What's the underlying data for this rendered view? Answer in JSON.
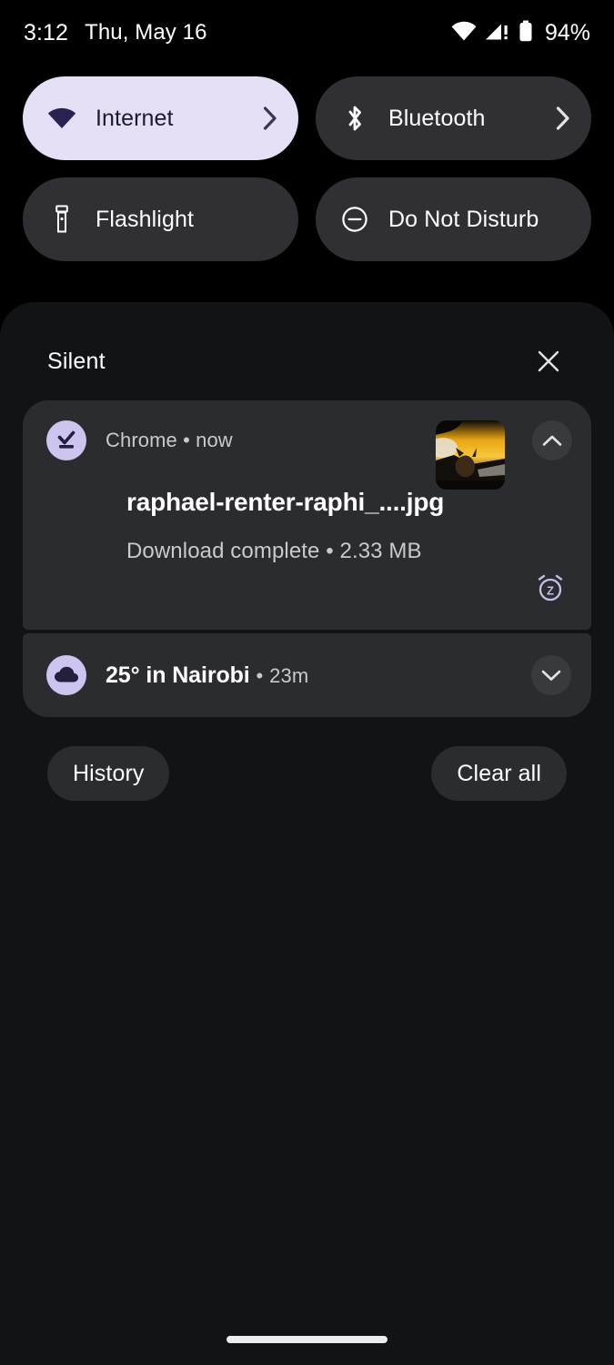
{
  "status_bar": {
    "time": "3:12",
    "date": "Thu, May 16",
    "battery_percent": "94%",
    "icons": [
      "wifi-icon",
      "cellular-signal-warning-icon",
      "battery-icon"
    ]
  },
  "quick_settings": {
    "tiles": [
      {
        "label": "Internet",
        "icon": "wifi-icon",
        "active": true,
        "has_chevron": true
      },
      {
        "label": "Bluetooth",
        "icon": "bluetooth-icon",
        "active": false,
        "has_chevron": true
      },
      {
        "label": "Flashlight",
        "icon": "flashlight-icon",
        "active": false,
        "has_chevron": false
      },
      {
        "label": "Do Not Disturb",
        "icon": "do-not-disturb-icon",
        "active": false,
        "has_chevron": false
      }
    ],
    "active_background": "#e6e0f7",
    "active_foreground": "#1d1a2e",
    "inactive_background": "#303034"
  },
  "shade": {
    "section_title": "Silent",
    "close_icon": "close-icon",
    "notifications": [
      {
        "app_name": "Chrome",
        "separator": "•",
        "time": "now",
        "app_icon": "download-complete-icon",
        "title": "raphael-renter-raphi_....jpg",
        "body": "Download complete • 2.33 MB",
        "thumbnail": "sunset-photo-thumbnail",
        "collapse_icon": "chevron-up-icon",
        "snooze_icon": "snooze-alarm-icon"
      },
      {
        "app_icon": "cloud-weather-icon",
        "title": "25° in Nairobi",
        "separator": "•",
        "time": "23m",
        "expand_icon": "chevron-down-icon"
      }
    ],
    "footer": {
      "history_label": "History",
      "clear_all_label": "Clear all"
    }
  },
  "nav_bar": {
    "handle": "gesture-nav-handle"
  }
}
